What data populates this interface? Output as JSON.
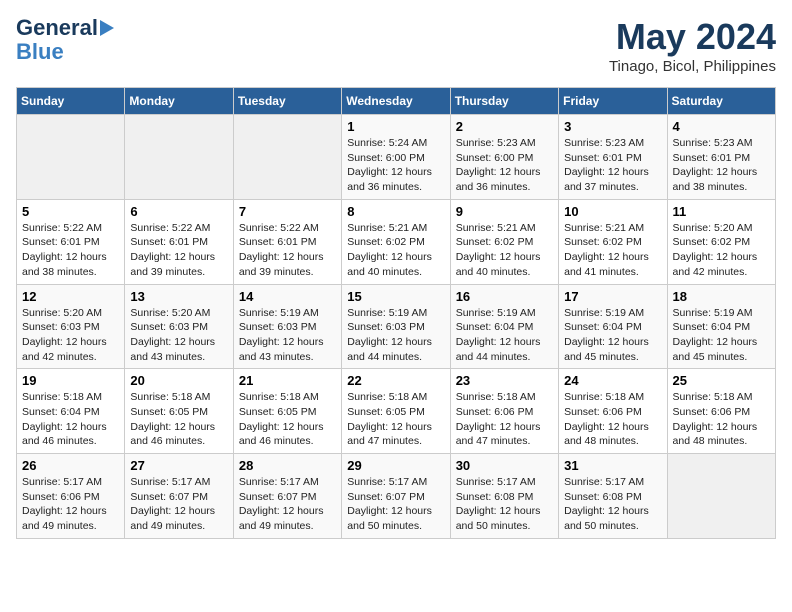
{
  "logo": {
    "line1": "General",
    "line2": "Blue"
  },
  "header": {
    "month_year": "May 2024",
    "location": "Tinago, Bicol, Philippines"
  },
  "weekdays": [
    "Sunday",
    "Monday",
    "Tuesday",
    "Wednesday",
    "Thursday",
    "Friday",
    "Saturday"
  ],
  "weeks": [
    [
      {
        "day": "",
        "sunrise": "",
        "sunset": "",
        "daylight": "",
        "empty": true
      },
      {
        "day": "",
        "sunrise": "",
        "sunset": "",
        "daylight": "",
        "empty": true
      },
      {
        "day": "",
        "sunrise": "",
        "sunset": "",
        "daylight": "",
        "empty": true
      },
      {
        "day": "1",
        "sunrise": "Sunrise: 5:24 AM",
        "sunset": "Sunset: 6:00 PM",
        "daylight": "Daylight: 12 hours and 36 minutes."
      },
      {
        "day": "2",
        "sunrise": "Sunrise: 5:23 AM",
        "sunset": "Sunset: 6:00 PM",
        "daylight": "Daylight: 12 hours and 36 minutes."
      },
      {
        "day": "3",
        "sunrise": "Sunrise: 5:23 AM",
        "sunset": "Sunset: 6:01 PM",
        "daylight": "Daylight: 12 hours and 37 minutes."
      },
      {
        "day": "4",
        "sunrise": "Sunrise: 5:23 AM",
        "sunset": "Sunset: 6:01 PM",
        "daylight": "Daylight: 12 hours and 38 minutes."
      }
    ],
    [
      {
        "day": "5",
        "sunrise": "Sunrise: 5:22 AM",
        "sunset": "Sunset: 6:01 PM",
        "daylight": "Daylight: 12 hours and 38 minutes."
      },
      {
        "day": "6",
        "sunrise": "Sunrise: 5:22 AM",
        "sunset": "Sunset: 6:01 PM",
        "daylight": "Daylight: 12 hours and 39 minutes."
      },
      {
        "day": "7",
        "sunrise": "Sunrise: 5:22 AM",
        "sunset": "Sunset: 6:01 PM",
        "daylight": "Daylight: 12 hours and 39 minutes."
      },
      {
        "day": "8",
        "sunrise": "Sunrise: 5:21 AM",
        "sunset": "Sunset: 6:02 PM",
        "daylight": "Daylight: 12 hours and 40 minutes."
      },
      {
        "day": "9",
        "sunrise": "Sunrise: 5:21 AM",
        "sunset": "Sunset: 6:02 PM",
        "daylight": "Daylight: 12 hours and 40 minutes."
      },
      {
        "day": "10",
        "sunrise": "Sunrise: 5:21 AM",
        "sunset": "Sunset: 6:02 PM",
        "daylight": "Daylight: 12 hours and 41 minutes."
      },
      {
        "day": "11",
        "sunrise": "Sunrise: 5:20 AM",
        "sunset": "Sunset: 6:02 PM",
        "daylight": "Daylight: 12 hours and 42 minutes."
      }
    ],
    [
      {
        "day": "12",
        "sunrise": "Sunrise: 5:20 AM",
        "sunset": "Sunset: 6:03 PM",
        "daylight": "Daylight: 12 hours and 42 minutes."
      },
      {
        "day": "13",
        "sunrise": "Sunrise: 5:20 AM",
        "sunset": "Sunset: 6:03 PM",
        "daylight": "Daylight: 12 hours and 43 minutes."
      },
      {
        "day": "14",
        "sunrise": "Sunrise: 5:19 AM",
        "sunset": "Sunset: 6:03 PM",
        "daylight": "Daylight: 12 hours and 43 minutes."
      },
      {
        "day": "15",
        "sunrise": "Sunrise: 5:19 AM",
        "sunset": "Sunset: 6:03 PM",
        "daylight": "Daylight: 12 hours and 44 minutes."
      },
      {
        "day": "16",
        "sunrise": "Sunrise: 5:19 AM",
        "sunset": "Sunset: 6:04 PM",
        "daylight": "Daylight: 12 hours and 44 minutes."
      },
      {
        "day": "17",
        "sunrise": "Sunrise: 5:19 AM",
        "sunset": "Sunset: 6:04 PM",
        "daylight": "Daylight: 12 hours and 45 minutes."
      },
      {
        "day": "18",
        "sunrise": "Sunrise: 5:19 AM",
        "sunset": "Sunset: 6:04 PM",
        "daylight": "Daylight: 12 hours and 45 minutes."
      }
    ],
    [
      {
        "day": "19",
        "sunrise": "Sunrise: 5:18 AM",
        "sunset": "Sunset: 6:04 PM",
        "daylight": "Daylight: 12 hours and 46 minutes."
      },
      {
        "day": "20",
        "sunrise": "Sunrise: 5:18 AM",
        "sunset": "Sunset: 6:05 PM",
        "daylight": "Daylight: 12 hours and 46 minutes."
      },
      {
        "day": "21",
        "sunrise": "Sunrise: 5:18 AM",
        "sunset": "Sunset: 6:05 PM",
        "daylight": "Daylight: 12 hours and 46 minutes."
      },
      {
        "day": "22",
        "sunrise": "Sunrise: 5:18 AM",
        "sunset": "Sunset: 6:05 PM",
        "daylight": "Daylight: 12 hours and 47 minutes."
      },
      {
        "day": "23",
        "sunrise": "Sunrise: 5:18 AM",
        "sunset": "Sunset: 6:06 PM",
        "daylight": "Daylight: 12 hours and 47 minutes."
      },
      {
        "day": "24",
        "sunrise": "Sunrise: 5:18 AM",
        "sunset": "Sunset: 6:06 PM",
        "daylight": "Daylight: 12 hours and 48 minutes."
      },
      {
        "day": "25",
        "sunrise": "Sunrise: 5:18 AM",
        "sunset": "Sunset: 6:06 PM",
        "daylight": "Daylight: 12 hours and 48 minutes."
      }
    ],
    [
      {
        "day": "26",
        "sunrise": "Sunrise: 5:17 AM",
        "sunset": "Sunset: 6:06 PM",
        "daylight": "Daylight: 12 hours and 49 minutes."
      },
      {
        "day": "27",
        "sunrise": "Sunrise: 5:17 AM",
        "sunset": "Sunset: 6:07 PM",
        "daylight": "Daylight: 12 hours and 49 minutes."
      },
      {
        "day": "28",
        "sunrise": "Sunrise: 5:17 AM",
        "sunset": "Sunset: 6:07 PM",
        "daylight": "Daylight: 12 hours and 49 minutes."
      },
      {
        "day": "29",
        "sunrise": "Sunrise: 5:17 AM",
        "sunset": "Sunset: 6:07 PM",
        "daylight": "Daylight: 12 hours and 50 minutes."
      },
      {
        "day": "30",
        "sunrise": "Sunrise: 5:17 AM",
        "sunset": "Sunset: 6:08 PM",
        "daylight": "Daylight: 12 hours and 50 minutes."
      },
      {
        "day": "31",
        "sunrise": "Sunrise: 5:17 AM",
        "sunset": "Sunset: 6:08 PM",
        "daylight": "Daylight: 12 hours and 50 minutes."
      },
      {
        "day": "",
        "sunrise": "",
        "sunset": "",
        "daylight": "",
        "empty": true
      }
    ]
  ]
}
